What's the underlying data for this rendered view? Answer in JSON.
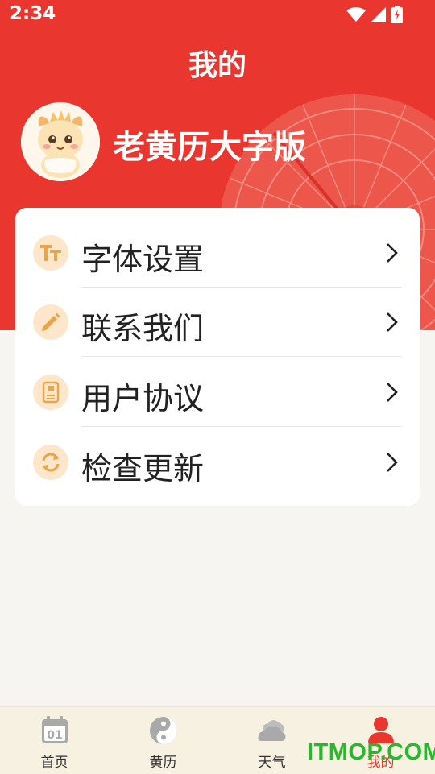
{
  "status_bar": {
    "time": "2:34"
  },
  "header": {
    "title": "我的",
    "app_name": "老黄历大字版"
  },
  "menu": {
    "items": [
      {
        "label": "字体设置",
        "icon": "font-size-icon"
      },
      {
        "label": "联系我们",
        "icon": "pencil-icon"
      },
      {
        "label": "用户协议",
        "icon": "document-icon"
      },
      {
        "label": "检查更新",
        "icon": "refresh-icon"
      }
    ]
  },
  "tabs": [
    {
      "label": "首页",
      "icon": "calendar-icon",
      "active": false
    },
    {
      "label": "黄历",
      "icon": "yin-yang-icon",
      "active": false
    },
    {
      "label": "天气",
      "icon": "cloud-icon",
      "active": false
    },
    {
      "label": "我的",
      "icon": "user-icon",
      "active": true
    }
  ],
  "watermark": "ITMOP.COM",
  "colors": {
    "primary": "#e9362f",
    "icon_bg": "#fde6c9",
    "icon_fg": "#e8a54a",
    "tab_bar_bg": "#f6f1e1",
    "watermark": "#27b82b"
  }
}
